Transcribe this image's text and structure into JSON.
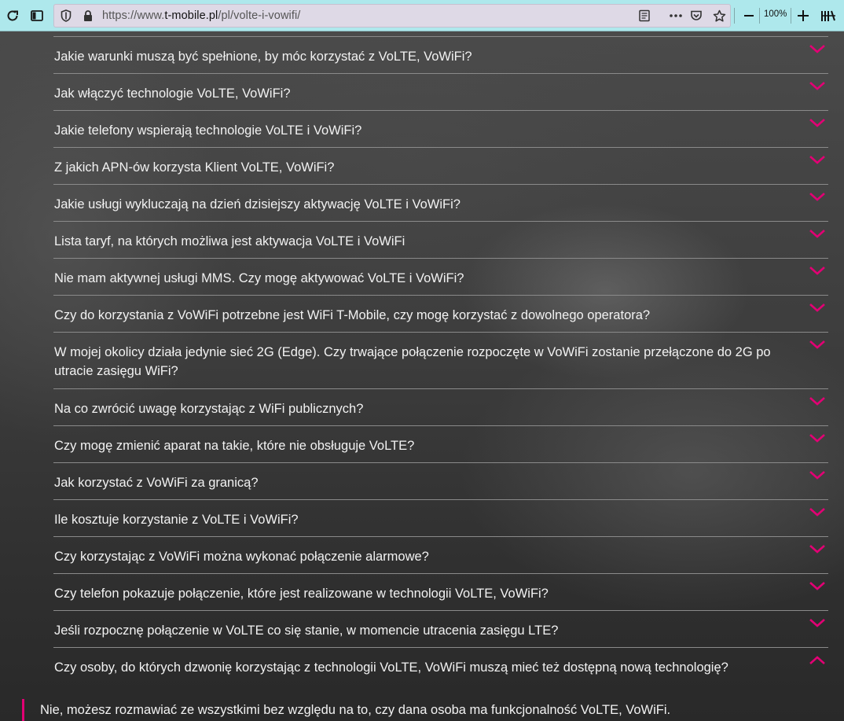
{
  "browser": {
    "url_prefix": "https://www.",
    "url_domain": "t-mobile.pl",
    "url_path": "/pl/volte-i-vowifi/",
    "zoom": "100%",
    "icons": [
      "reload-icon",
      "sidebar-icon",
      "shield-icon",
      "lock-icon",
      "reader-icon",
      "more-icon",
      "pocket-icon",
      "bookmark-star-icon",
      "zoom-out-icon",
      "zoom-in-icon",
      "library-icon"
    ]
  },
  "accent_color": "#e20074",
  "faq": [
    {
      "q": "Jakie warunki muszą być spełnione, by móc korzystać z VoLTE, VoWiFi?"
    },
    {
      "q": "Jak włączyć technologie VoLTE, VoWiFi?"
    },
    {
      "q": "Jakie telefony wspierają technologie VoLTE i VoWiFi?"
    },
    {
      "q": "Z jakich APN-ów korzysta Klient VoLTE, VoWiFi?"
    },
    {
      "q": "Jakie usługi wykluczają na dzień dzisiejszy aktywację VoLTE i VoWiFi?"
    },
    {
      "q": "Lista taryf, na których możliwa jest aktywacja VoLTE i VoWiFi"
    },
    {
      "q": "Nie mam aktywnej usługi MMS. Czy mogę aktywować VoLTE i VoWiFi?"
    },
    {
      "q": "Czy do korzystania z VoWiFi potrzebne jest WiFi T-Mobile, czy mogę korzystać z dowolnego operatora?"
    },
    {
      "q": "W mojej okolicy działa jedynie sieć 2G (Edge). Czy trwające połączenie rozpoczęte w VoWiFi zostanie przełączone do 2G po utracie zasięgu WiFi?"
    },
    {
      "q": "Na co zwrócić uwagę korzystając z WiFi publicznych?"
    },
    {
      "q": "Czy mogę zmienić aparat na takie, które nie obsługuje VoLTE?"
    },
    {
      "q": "Jak korzystać z VoWiFi za granicą?"
    },
    {
      "q": "Ile kosztuje korzystanie z VoLTE i VoWiFi?"
    },
    {
      "q": "Czy korzystając z VoWiFi można wykonać połączenie alarmowe?"
    },
    {
      "q": "Czy telefon pokazuje połączenie, które jest realizowane w technologii VoLTE, VoWiFi?"
    },
    {
      "q": "Jeśli rozpocznę połączenie w VoLTE co się stanie, w momencie utracenia zasięgu LTE?"
    },
    {
      "q": "Czy osoby, do których dzwonię korzystając z technologii VoLTE, VoWiFi muszą mieć też dostępną nową technologię?",
      "expanded": true,
      "answer": "Nie, możesz rozmawiać ze wszystkimi bez względu na to, czy dana osoba ma funkcjonalność VoLTE, VoWiFi."
    }
  ]
}
